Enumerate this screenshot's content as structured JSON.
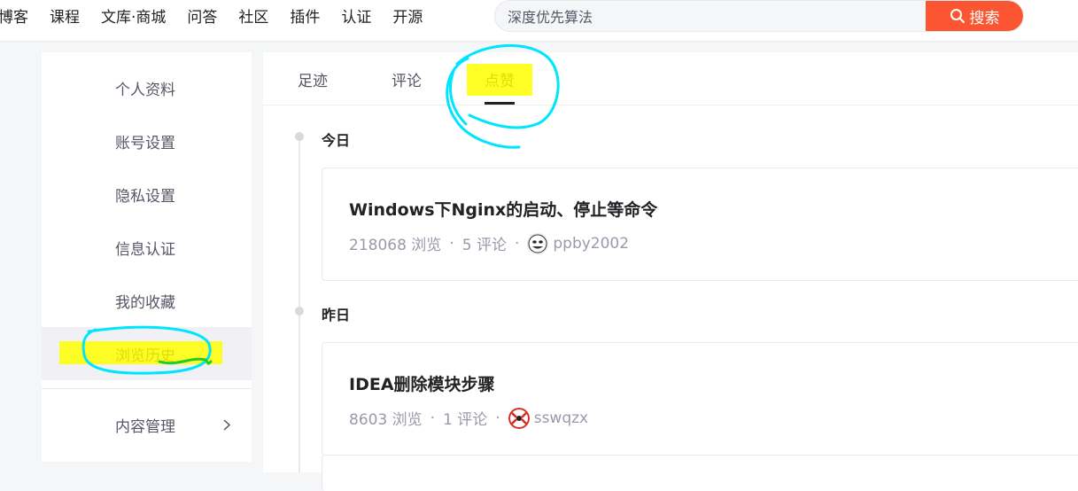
{
  "topnav": {
    "items": [
      "博客",
      "课程",
      "文库·商城",
      "问答",
      "社区",
      "插件",
      "认证",
      "开源"
    ]
  },
  "search": {
    "value": "深度优先算法",
    "button_label": "搜索"
  },
  "sidebar": {
    "items": [
      {
        "label": "个人资料"
      },
      {
        "label": "账号设置"
      },
      {
        "label": "隐私设置"
      },
      {
        "label": "信息认证"
      },
      {
        "label": "我的收藏"
      },
      {
        "label": "浏览历史"
      },
      {
        "label": "内容管理"
      }
    ],
    "active": "浏览历史"
  },
  "tabs": {
    "items": [
      {
        "label": "足迹"
      },
      {
        "label": "评论"
      },
      {
        "label": "点赞"
      }
    ],
    "active": "点赞"
  },
  "history": {
    "days": [
      {
        "label": "今日",
        "items": [
          {
            "title": "Windows下Nginx的启动、停止等命令",
            "views": "218068 浏览",
            "comments": "5 评论",
            "author": "ppby2002"
          }
        ]
      },
      {
        "label": "昨日",
        "items": [
          {
            "title": "IDEA删除模块步骤",
            "views": "8603 浏览",
            "comments": "1 评论",
            "author": "sswqzx"
          }
        ]
      }
    ]
  },
  "meta_separator": "·",
  "colors": {
    "accent": "#fc5531",
    "highlight": "#ffff00",
    "annotation_circle": "#00e5ff",
    "annotation_pen": "#22cc22"
  }
}
